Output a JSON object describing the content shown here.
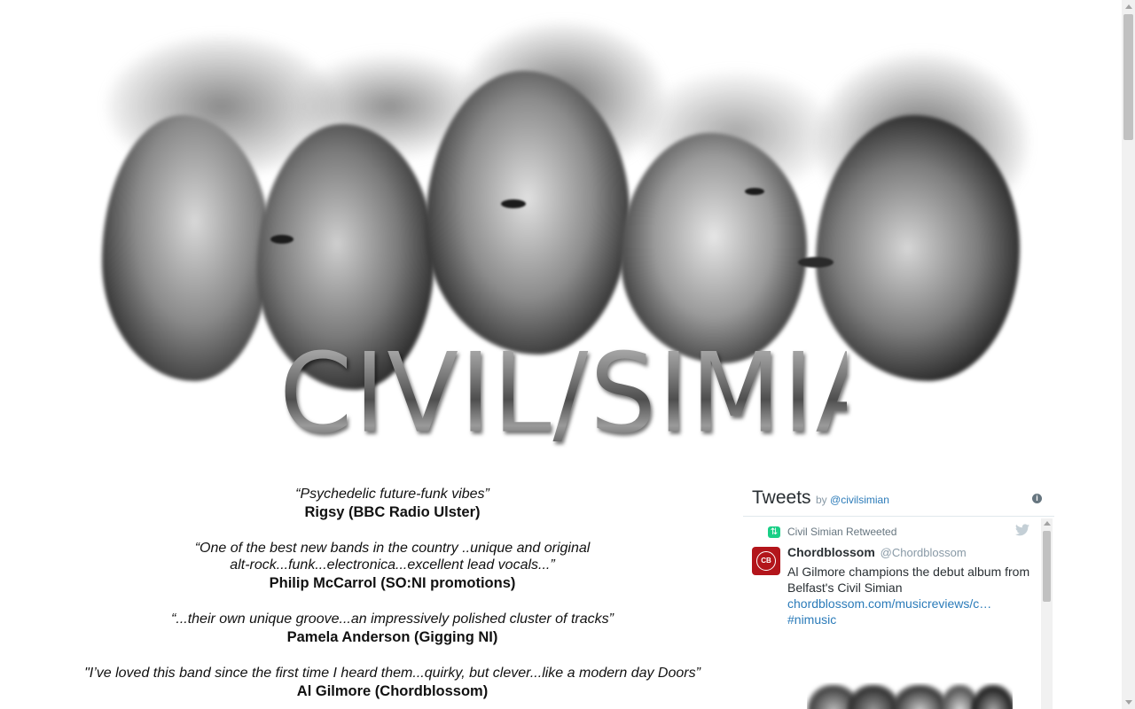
{
  "banner": {
    "logo_text": "CIVIL/SIMIAN",
    "image_icon": "band-portrait-smoke-image"
  },
  "quotes": [
    {
      "text": "“Psychedelic future-funk vibes”",
      "author": "Rigsy (BBC Radio Ulster)"
    },
    {
      "text": "“One of the best new bands in the country ..unique and original alt-rock...funk...electronica...excellent lead vocals...”",
      "author": "Philip McCarrol (SO:NI promotions)"
    },
    {
      "text": "“...their own unique groove...an impressively polished cluster of tracks”",
      "author": "Pamela Anderson (Gigging NI)"
    },
    {
      "text": "\"I’ve loved this band since the first time I heard them...quirky, but clever...like a modern day Doors”",
      "author": "Al Gilmore (Chordblossom)"
    }
  ],
  "twitter": {
    "title": "Tweets",
    "by_prefix": "by",
    "by_handle": "@civilsimian",
    "info_icon": "info-icon",
    "retweet_label": "Civil Simian Retweeted",
    "retweet_icon": "retweet-icon",
    "bird_icon": "twitter-bird-icon",
    "tweet": {
      "avatar_text": "CB",
      "author_name": "Chordblossom",
      "author_handle": "@Chordblossom",
      "text": "Al Gilmore champions the debut album from Belfast's Civil Simian",
      "link": "chordblossom.com/musicreviews/c…",
      "hashtag": "#nimusic"
    },
    "accent_color": "#2b7bb9",
    "retweet_color": "#19cf86",
    "avatar_color": "#b3151b"
  }
}
